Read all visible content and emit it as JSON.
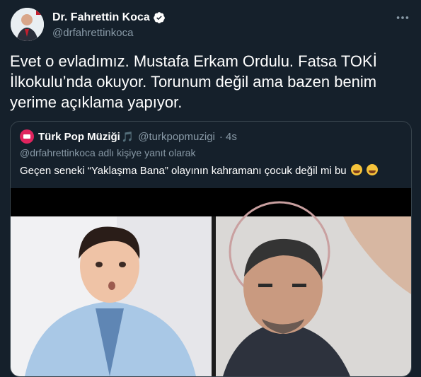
{
  "author": {
    "name": "Dr. Fahrettin Koca",
    "handle": "@drfahrettinkoca"
  },
  "tweet": {
    "text": "Evet o evladımız. Mustafa Erkam Ordulu. Fatsa TOKİ İlkokulu’nda okuyor. Torunum değil ama bazen benim yerime açıklama yapıyor."
  },
  "quoted": {
    "name": "Türk Pop Müziği",
    "name_emoji": "🎵",
    "handle": "@turkpopmuzigi",
    "time": "· 4s",
    "reply_to": "@drfahrettinkoca adlı kişiye yanıt olarak",
    "text": "Geçen seneki “Yaklaşma Bana” olayının kahramanı çocuk değil mi bu"
  },
  "colors": {
    "background": "#15202b",
    "secondary_text": "#8899a6",
    "border": "#38444d",
    "verified": "#ffffff"
  }
}
